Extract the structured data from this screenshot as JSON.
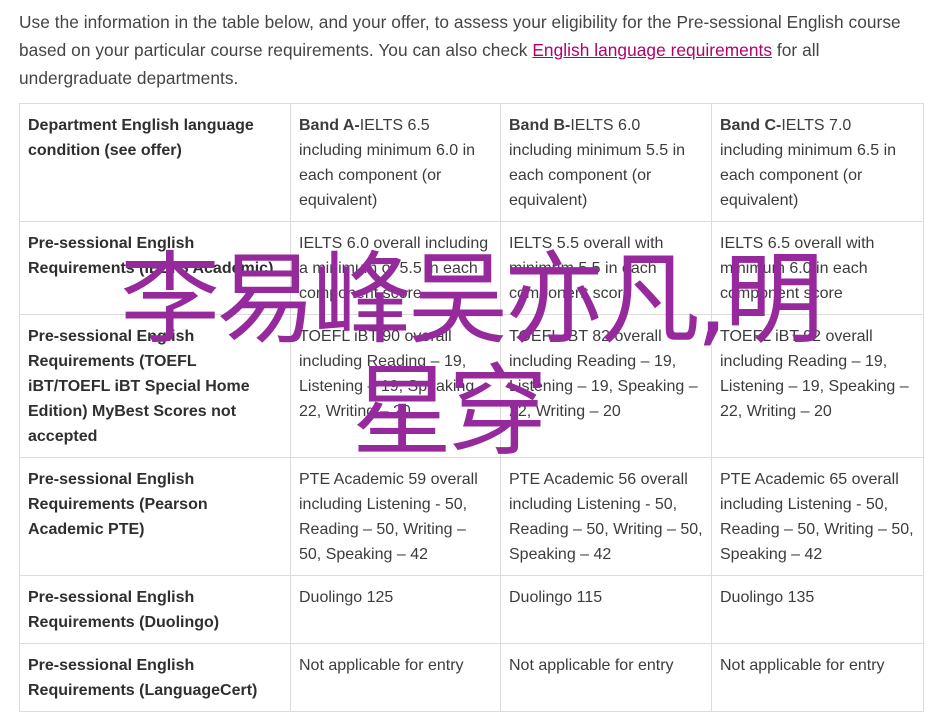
{
  "intro": {
    "text_before": "Use the information in the table below, and your offer, to assess your eligibility for the Pre-sessional English course based on your particular course requirements. You can also check ",
    "link": "English language requirements",
    "text_after": " for all undergraduate departments."
  },
  "table": {
    "header": {
      "label": "Department English language condition (see offer)",
      "bands": [
        {
          "name": "Band A-",
          "detail": "IELTS 6.5 including minimum 6.0 in each component (or equivalent)"
        },
        {
          "name": "Band B-",
          "detail": "IELTS 6.0 including minimum 5.5 in each component (or equivalent)"
        },
        {
          "name": "Band C-",
          "detail": "IELTS 7.0 including minimum 6.5 in each component (or equivalent)"
        }
      ]
    },
    "rows": [
      {
        "label": "Pre-sessional English Requirements (IELTS Academic)",
        "cells": [
          "IELTS 6.0 overall including a minimum of 5.5 in each component score",
          "IELTS 5.5 overall with minimum 5.5 in each component score",
          "IELTS 6.5 overall with minimum 6.0 in each component score"
        ]
      },
      {
        "label": "Pre-sessional English Requirements (TOEFL iBT/TOEFL iBT Special Home Edition) MyBest Scores not accepted",
        "cells": [
          "TOEFL iBT 90 overall including Reading – 19, Listening – 19, Speaking – 22, Writing – 20",
          "TOEFL iBT 82 overall including Reading – 19, Listening – 19, Speaking – 22, Writing – 20",
          "TOEFL iBT 92 overall including Reading – 19, Listening – 19, Speaking – 22, Writing – 20"
        ]
      },
      {
        "label": "Pre-sessional English Requirements (Pearson Academic PTE)",
        "cells": [
          "PTE Academic 59 overall including Listening - 50, Reading – 50, Writing – 50, Speaking – 42",
          "PTE Academic 56 overall including Listening - 50, Reading – 50, Writing – 50, Speaking – 42",
          "PTE Academic 65 overall including Listening - 50, Reading – 50, Writing – 50, Speaking – 42"
        ]
      },
      {
        "label": "Pre-sessional English Requirements (Duolingo)",
        "cells": [
          "Duolingo 125",
          "Duolingo 115",
          "Duolingo 135"
        ]
      },
      {
        "label": "Pre-sessional English Requirements (LanguageCert)",
        "cells": [
          "Not applicable for entry",
          "Not applicable for entry",
          "Not applicable for entry"
        ]
      }
    ]
  },
  "overlay": {
    "line1": "李易峰吴亦凡,明",
    "line2": "星穿",
    "color": "#96299b"
  },
  "colors": {
    "link": "#b0006b",
    "border": "#dcdcdc",
    "text": "#3c3c3c"
  }
}
